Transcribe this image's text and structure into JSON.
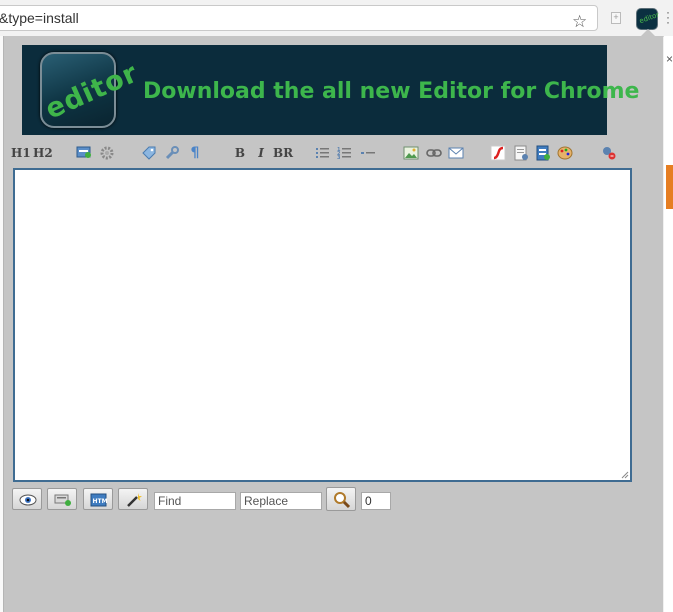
{
  "browser": {
    "url_fragment": "&type=install",
    "bookmark_icon": "star-icon",
    "extension_label": "editor"
  },
  "banner": {
    "logo_text": "editor",
    "headline": "Download the all new Editor for Chrome",
    "bg_color": "#0b2c3c",
    "text_color": "#3db64c"
  },
  "toolbar": {
    "h1": "H1",
    "h2": "H2",
    "bold": "B",
    "italic": "I",
    "br": "BR",
    "icons": [
      "insert-html-icon",
      "settings-icon",
      "tag-icon",
      "wrench-icon",
      "paragraph-icon",
      "unordered-list-icon",
      "ordered-list-icon",
      "horizontal-rule-icon",
      "image-icon",
      "link-icon",
      "email-icon",
      "flash-icon",
      "page-icon",
      "table-icon",
      "color-palette-icon",
      "plugin-icon"
    ]
  },
  "editor": {
    "content": ""
  },
  "bottombar": {
    "icons": [
      "preview-eye-icon",
      "insert-block-icon",
      "html-source-icon",
      "magic-wand-icon",
      "search-icon"
    ],
    "find_placeholder": "Find",
    "replace_placeholder": "Replace",
    "count_value": "0"
  },
  "colors": {
    "popup_bg": "#c5c5c5",
    "editor_border": "#3f6c92"
  }
}
